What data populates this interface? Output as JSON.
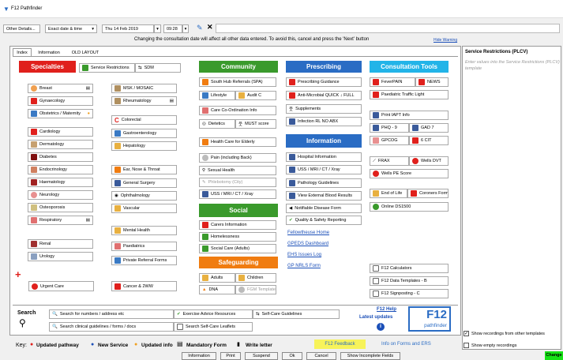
{
  "app": {
    "title": "F12 Pathfinder"
  },
  "toolbar": {
    "other_details": "Other Details...",
    "date_mode": "Exact date & time",
    "date": "Thu 14 Feb 2019",
    "time": "09:28"
  },
  "warning": {
    "text": "Changing the consultation date will affect all other data entered. To avoid this, cancel and press the 'Next' button",
    "hide": "Hide Warning"
  },
  "tabs": [
    "Index",
    "Information",
    "OLD LAYOUT"
  ],
  "headers": {
    "specialties": "Specialties",
    "community": "Community",
    "prescribing": "Prescribing",
    "consultation_tools": "Consultation Tools",
    "information": "Information",
    "social": "Social",
    "safeguarding": "Safeguarding"
  },
  "specialties": {
    "service_restrictions": "Service Restrictions",
    "sdm": "SDM",
    "col1": [
      "Breast",
      "Gynaecology",
      "Obstetrics / Maternity",
      "Cardiology",
      "Dermatology",
      "Diabetes",
      "Endocrinology",
      "Haematology",
      "Neurology",
      "Osteoporosis",
      "Respiratory",
      "Renal",
      "Urology"
    ],
    "col2": [
      "MSK / MOSAIC",
      "Rheumatology",
      "Colorectal",
      "Gastroenterology",
      "Hepatology",
      "Ear, Nose & Throat",
      "General Surgery",
      "Ophthalmology",
      "Vascular",
      "Mental Health",
      "Paediatrics",
      "Private Referral Forms"
    ],
    "urgent_care": "Urgent Care",
    "cancer": "Cancer & 2WW"
  },
  "community": {
    "south_hub": "South Hub Referrals (SPA)",
    "lifestyle": "Lifestyle",
    "audit_c": "Audit C",
    "care_coord": "Care Co-Ordination Info",
    "dietetics": "Dietetics",
    "must": "MUST score",
    "elderly": "Health Care for Elderly",
    "pain": "Pain (including Back)",
    "sexual": "Sexual Health",
    "phlebotomy": "Phlebotomy (City)",
    "uss": "USS / MRI / CT / Xray"
  },
  "social": {
    "carers": "Carers Information",
    "homelessness": "Homelessness",
    "social_care": "Social Care (Adults)"
  },
  "safeguarding": {
    "adults": "Adults",
    "children": "Children",
    "dna": "DNA",
    "fgm": "FGM Template"
  },
  "prescribing": {
    "guidance": "Prescribing Guidance",
    "antimicrobial": "Anti-Microbial QUICK ↓ FULL",
    "supplements": "Supplements",
    "infection": "Infection RL NO ABX"
  },
  "information": {
    "items": [
      "Hospital Information",
      "USS / MRI / CT / Xray",
      "Pathology Guidelines",
      "View External Blood Results",
      "Notifiable Disease Form",
      "Quality & Safety Reporting"
    ],
    "links": [
      "Fellowtheuse Home",
      "GPEDS Dashboard",
      "EHS Issues Log",
      "GP NRLS Form"
    ]
  },
  "tools": {
    "feverpain": "FeverPAIN",
    "news": "NEWS",
    "traffic": "Paediatric Traffic Light",
    "iapt": "Print IAPT Info",
    "phq": "PHQ - 9",
    "gad": "GAD 7",
    "gpcog": "GPCOG",
    "cit": "6 CIT",
    "frax": "FRAX",
    "wells_dvt": "Wells DVT",
    "wells_pe": "Wells PE Score",
    "eol": "End of Life",
    "coroners": "Coroners Form",
    "ds1500": "Online DS1500",
    "calculators": "F12 Calculators",
    "templates": "F12 Data Templates - B",
    "signposting": "F12 Signposting - C"
  },
  "search": {
    "label": "Search",
    "nurses": "Search for numbers / address etc",
    "clinical": "Search clinical guidelines / forms / docs",
    "exercise": "Exercise Advice Resources",
    "selfcare": "Self-Care Guidelines",
    "leaflets": "Search Self-Care Leaflets"
  },
  "f12": {
    "help": "F12 Help",
    "latest": "Latest updates",
    "logo_big": "F12",
    "logo_small": "pathfinder"
  },
  "key": {
    "label": "Key:",
    "updated": "Updated pathway",
    "new": "New Service",
    "info": "Updated info",
    "mandatory": "Mandatory Form",
    "write": "Write letter",
    "feedback": "F12 Feedback",
    "forms_info": "Info on Forms and ERS"
  },
  "right_panel": {
    "title": "Service Restrictions (PLCV)",
    "hint": "Enter values into the Service Restrictions (PLCV) template",
    "show_other": "Show recordings from other templates",
    "show_empty": "Show empty recordings",
    "change": "Change"
  },
  "bottom": [
    "Information",
    "Print",
    "Suspend",
    "Ok",
    "Cancel",
    "Show Incomplete Fields"
  ],
  "colors": {
    "red": "#e0201c",
    "green": "#3a9a2c",
    "blue": "#2a6cc4",
    "cyan": "#22b4e8",
    "orange": "#f07c10",
    "yellow": "#f7f35a",
    "neon": "#16e216"
  }
}
